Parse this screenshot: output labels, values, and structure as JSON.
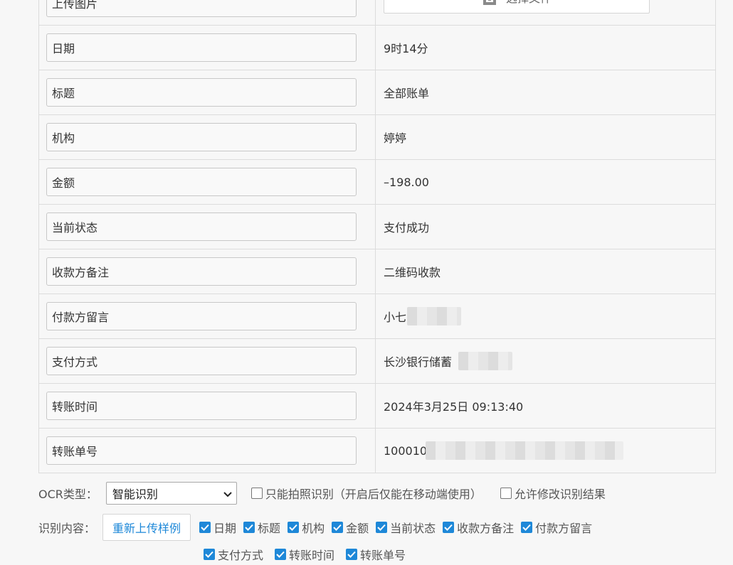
{
  "fields": [
    {
      "label": "上传图片",
      "value": ""
    },
    {
      "label": "日期",
      "value": "9时14分"
    },
    {
      "label": "标题",
      "value": "全部账单"
    },
    {
      "label": "机构",
      "value": "婷婷"
    },
    {
      "label": "金额",
      "value": "–198.00"
    },
    {
      "label": "当前状态",
      "value": "支付成功"
    },
    {
      "label": "收款方备注",
      "value": "二维码收款"
    },
    {
      "label": "付款方留言",
      "value": "小七"
    },
    {
      "label": "支付方式",
      "value": "长沙银行储蓄"
    },
    {
      "label": "转账时间",
      "value": "2024年3月25日 09:13:40"
    },
    {
      "label": "转账单号",
      "value": "100010"
    }
  ],
  "upload": {
    "button_label": "选择文件"
  },
  "ocr": {
    "type_label": "OCR类型：",
    "selected": "智能识别",
    "photo_only_label": "只能拍照识别（开启后仅能在移动端使用）",
    "allow_edit_label": "允许修改识别结果"
  },
  "content": {
    "label": "识别内容：",
    "reupload_label": "重新上传样例",
    "options": [
      "日期",
      "标题",
      "机构",
      "金额",
      "当前状态",
      "收款方备注",
      "付款方留言",
      "支付方式",
      "转账时间",
      "转账单号"
    ]
  },
  "colors": {
    "accent": "#1e88d8"
  }
}
